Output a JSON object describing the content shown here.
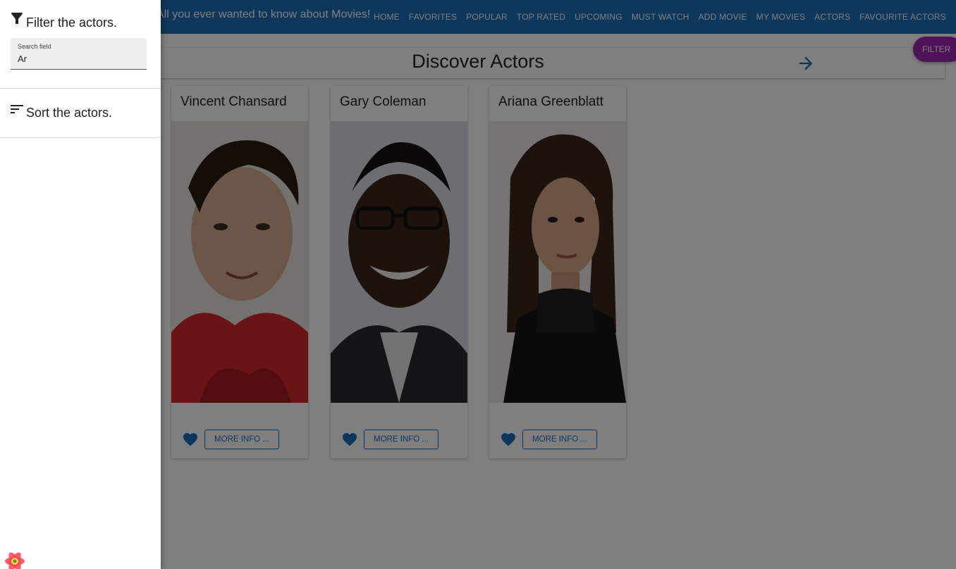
{
  "appbar": {
    "tagline": "All you ever wanted to know about Movies!",
    "nav": [
      "HOME",
      "FAVORITES",
      "POPULAR",
      "TOP RATED",
      "UPCOMING",
      "MUST WATCH",
      "ADD MOVIE",
      "MY MOVIES",
      "ACTORS",
      "FAVOURITE ACTORS"
    ]
  },
  "header": {
    "title": "Discover Actors",
    "next_icon": "arrow-forward-icon"
  },
  "filter_fab": {
    "label": "FILTER"
  },
  "actors": [
    {
      "name": "Vincent Chansard",
      "more_label": "MORE INFO ...",
      "favourite_icon": "heart-icon"
    },
    {
      "name": "Gary Coleman",
      "more_label": "MORE INFO ...",
      "favourite_icon": "heart-icon"
    },
    {
      "name": "Ariana Greenblatt",
      "more_label": "MORE INFO ...",
      "favourite_icon": "heart-icon"
    }
  ],
  "drawer": {
    "filter_title": "Filter the actors.",
    "filter_icon": "filter-icon",
    "search_label": "Search field",
    "search_value": "Ar",
    "sort_title": "Sort the actors.",
    "sort_icon": "sort-icon"
  },
  "colors": {
    "primary": "#1c6fb9",
    "fab": "#9c27b0",
    "backdrop": "rgba(0,0,0,0.5)"
  }
}
